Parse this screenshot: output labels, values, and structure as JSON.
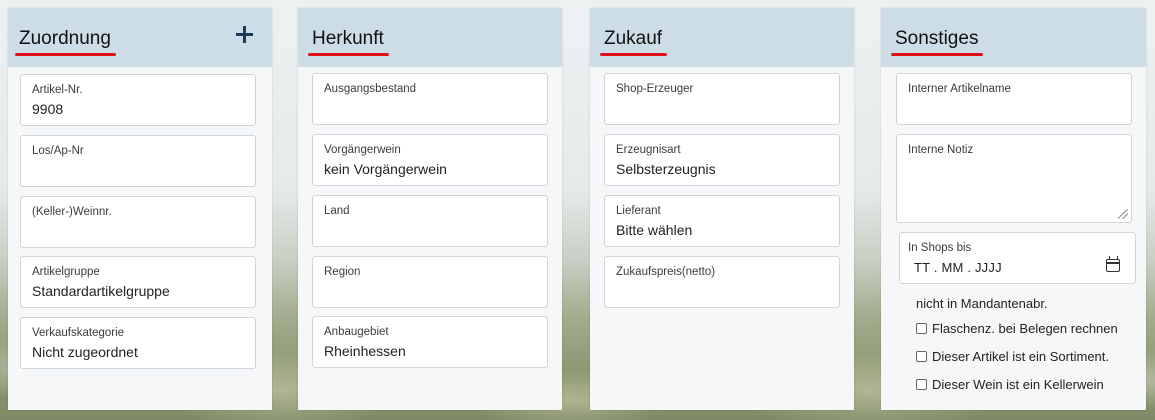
{
  "panels": {
    "zuordnung": {
      "title": "Zuordnung",
      "fields": [
        {
          "label": "Artikel-Nr.",
          "value": "9908"
        },
        {
          "label": "Los/Ap-Nr",
          "value": ""
        },
        {
          "label": "(Keller-)Weinnr.",
          "value": ""
        },
        {
          "label": "Artikelgruppe",
          "value": "Standardartikelgruppe"
        },
        {
          "label": "Verkaufskategorie",
          "value": "Nicht zugeordnet"
        }
      ]
    },
    "herkunft": {
      "title": "Herkunft",
      "fields": [
        {
          "label": "Ausgangsbestand",
          "value": ""
        },
        {
          "label": "Vorgängerwein",
          "value": "kein Vorgängerwein"
        },
        {
          "label": "Land",
          "value": ""
        },
        {
          "label": "Region",
          "value": ""
        },
        {
          "label": "Anbaugebiet",
          "value": "Rheinhessen"
        }
      ]
    },
    "zukauf": {
      "title": "Zukauf",
      "fields": [
        {
          "label": "Shop-Erzeuger",
          "value": ""
        },
        {
          "label": "Erzeugnisart",
          "value": "Selbsterzeugnis"
        },
        {
          "label": "Lieferant",
          "value": "Bitte wählen"
        },
        {
          "label": "Zukaufspreis(netto)",
          "value": ""
        }
      ]
    },
    "sonstiges": {
      "title": "Sonstiges",
      "internal_name_label": "Interner Artikelname",
      "internal_name_value": "",
      "internal_note_label": "Interne Notiz",
      "internal_note_value": "",
      "shops_until_label": "In Shops bis",
      "shops_until_value": "TT . MM . JJJJ",
      "mandant_text": "nicht in Mandantenabr.",
      "checkboxes": [
        {
          "label": "Flaschenz. bei Belegen rechnen",
          "checked": false
        },
        {
          "label": "Dieser Artikel ist ein Sortiment.",
          "checked": false
        },
        {
          "label": "Dieser Wein ist ein Kellerwein",
          "checked": false
        }
      ]
    }
  }
}
